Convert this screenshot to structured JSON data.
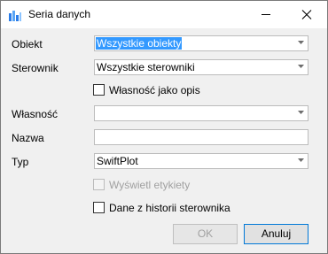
{
  "window": {
    "title": "Seria danych",
    "app_icon": "chart-bars-icon",
    "minimize_icon": "minimize-icon",
    "close_icon": "close-icon"
  },
  "form": {
    "obiekt": {
      "label": "Obiekt",
      "value": "Wszystkie obiekty"
    },
    "sterownik": {
      "label": "Sterownik",
      "value": "Wszystkie sterowniki"
    },
    "wlasnosc_jako_opis": {
      "label": "Własność jako opis",
      "checked": false
    },
    "wlasnosc": {
      "label": "Własność",
      "value": ""
    },
    "nazwa": {
      "label": "Nazwa",
      "value": ""
    },
    "typ": {
      "label": "Typ",
      "value": "SwiftPlot"
    },
    "wyswietl_etykiety": {
      "label": "Wyświetl etykiety",
      "checked": false,
      "enabled": false
    },
    "dane_z_historii": {
      "label": "Dane z historii sterownika",
      "checked": false
    }
  },
  "buttons": {
    "ok": {
      "label": "OK",
      "enabled": false
    },
    "cancel": {
      "label": "Anuluj",
      "enabled": true
    }
  },
  "colors": {
    "selection": "#3399ff",
    "accent": "#0078d7",
    "app_icon": "#2b7de9"
  }
}
